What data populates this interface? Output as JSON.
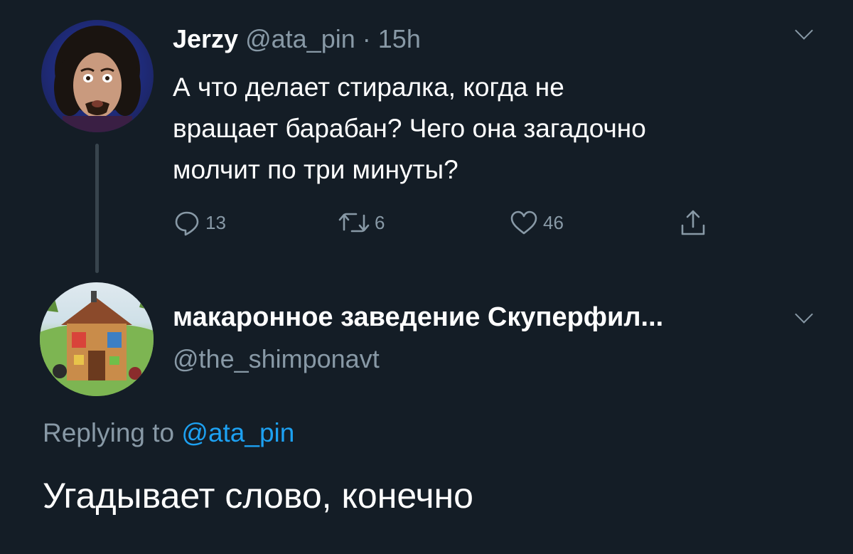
{
  "original_tweet": {
    "author_name": "Jerzy",
    "handle": "@ata_pin",
    "separator": "·",
    "time": "15h",
    "lines": [
      "А что делает стиралка, когда не",
      "вращает барабан? Чего она загадочно",
      "молчит по три минуты?"
    ],
    "actions": {
      "reply_count": "13",
      "retweet_count": "6",
      "like_count": "46"
    }
  },
  "reply_tweet": {
    "author_name": "макаронное заведение Скуперфил...",
    "handle": "@the_shimponavt",
    "replying_prefix": "Replying to",
    "replying_mention": "@ata_pin",
    "text": "Угадывает слово, конечно"
  },
  "colors": {
    "background": "#141d26",
    "secondary_text": "#8899a6",
    "mention": "#1da1f2",
    "thread_line": "#38444d"
  },
  "icons": [
    "reply-icon",
    "retweet-icon",
    "like-icon",
    "share-icon",
    "chevron-down-icon"
  ]
}
